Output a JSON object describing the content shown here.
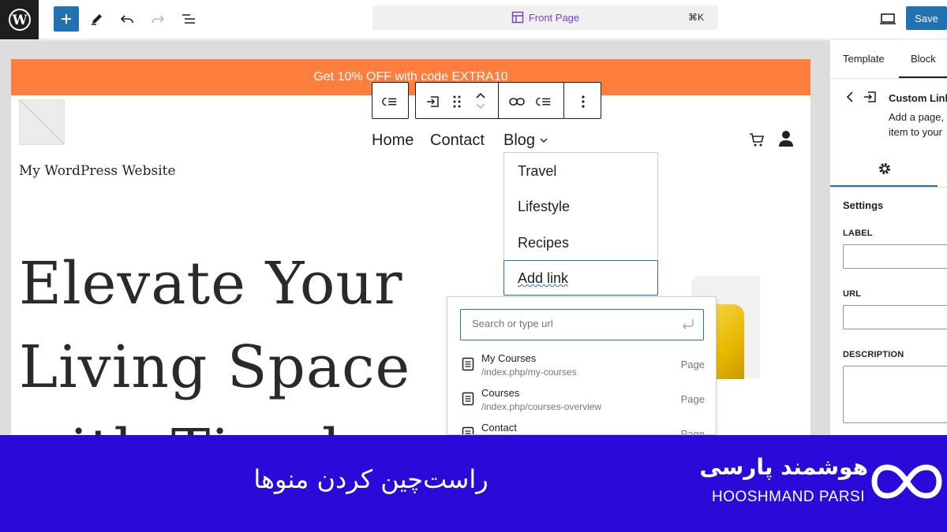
{
  "top_bar": {
    "command_title": "Front Page",
    "command_shortcut": "⌘K",
    "save_label": "Save"
  },
  "site": {
    "promo_text": "Get 10% OFF with code EXTRA10",
    "site_title": "My WordPress Website",
    "nav": [
      "Home",
      "Contact",
      "Blog"
    ],
    "hero_lines": [
      "Elevate Your",
      "Living Space",
      "with Timeless"
    ]
  },
  "submenu": {
    "items": [
      "Travel",
      "Lifestyle",
      "Recipes"
    ],
    "add_link_label": "Add link"
  },
  "link_popover": {
    "search_placeholder": "Search or type url",
    "results": [
      {
        "title": "My Courses",
        "url": "/index.php/my-courses",
        "type": "Page"
      },
      {
        "title": "Courses",
        "url": "/index.php/courses-overview",
        "type": "Page"
      },
      {
        "title": "Contact",
        "url": "",
        "type": "Page"
      }
    ]
  },
  "sidebar": {
    "tabs": [
      "Template",
      "Block"
    ],
    "block_name": "Custom Link",
    "block_desc_line1": "Add a page,",
    "block_desc_line2": "item to your",
    "settings_heading": "Settings",
    "fields": [
      "LABEL",
      "URL",
      "DESCRIPTION"
    ]
  },
  "banner": {
    "title_fa": "راست‌چین کردن منوها",
    "brand_fa": "هوشمند پارسی",
    "brand_en": "HOOSHMAND PARSI"
  },
  "colors": {
    "accent": "#2271b1",
    "promo": "#fe7e3e",
    "banner": "#2a0ad9"
  }
}
